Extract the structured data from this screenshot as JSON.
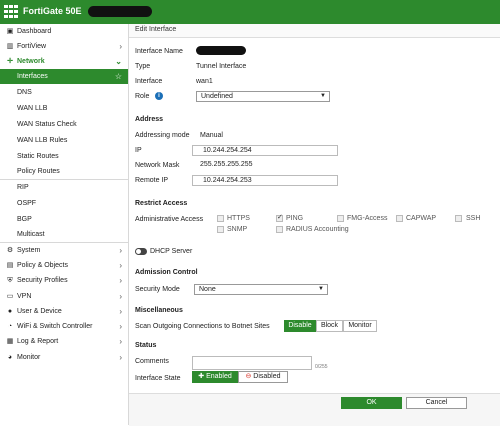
{
  "app": {
    "title": "FortiGate 50E"
  },
  "sidebar": {
    "items": [
      {
        "label": "Dashboard",
        "icon": "dashboard-icon"
      },
      {
        "label": "FortiView",
        "icon": "chart-icon"
      },
      {
        "label": "Network",
        "icon": "network-icon"
      },
      {
        "label": "Interfaces"
      },
      {
        "label": "DNS"
      },
      {
        "label": "WAN LLB"
      },
      {
        "label": "WAN Status Check"
      },
      {
        "label": "WAN LLB Rules"
      },
      {
        "label": "Static Routes"
      },
      {
        "label": "Policy Routes"
      },
      {
        "label": "RIP"
      },
      {
        "label": "OSPF"
      },
      {
        "label": "BGP"
      },
      {
        "label": "Multicast"
      },
      {
        "label": "System",
        "icon": "gear-icon"
      },
      {
        "label": "Policy & Objects",
        "icon": "policy-icon"
      },
      {
        "label": "Security Profiles",
        "icon": "shield-icon"
      },
      {
        "label": "VPN",
        "icon": "vpn-icon"
      },
      {
        "label": "User & Device",
        "icon": "user-icon"
      },
      {
        "label": "WiFi & Switch Controller",
        "icon": "wifi-icon"
      },
      {
        "label": "Log & Report",
        "icon": "log-icon"
      },
      {
        "label": "Monitor",
        "icon": "monitor-icon"
      }
    ]
  },
  "header": {
    "title": "Edit Interface"
  },
  "form": {
    "interface_name_label": "Interface Name",
    "type_label": "Type",
    "type_value": "Tunnel Interface",
    "interface_label": "Interface",
    "interface_value": "wan1",
    "role_label": "Role",
    "role_value": "Undefined",
    "address_heading": "Address",
    "addressing_mode_label": "Addressing mode",
    "addressing_mode_value": "Manual",
    "ip_label": "IP",
    "ip_value": "10.244.254.254",
    "netmask_label": "Network Mask",
    "netmask_value": "255.255.255.255",
    "remote_ip_label": "Remote IP",
    "remote_ip_value": "10.244.254.253",
    "restrict_heading": "Restrict Access",
    "admin_access_label": "Administrative Access",
    "access": {
      "https": "HTTPS",
      "ping": "PING",
      "fmg": "FMG-Access",
      "capwap": "CAPWAP",
      "ssh": "SSH",
      "snmp": "SNMP",
      "radius": "RADIUS Accounting"
    },
    "dhcp_label": "DHCP Server",
    "admission_heading": "Admission Control",
    "security_mode_label": "Security Mode",
    "security_mode_value": "None",
    "misc_heading": "Miscellaneous",
    "botnet_label": "Scan Outgoing Connections to Botnet Sites",
    "botnet_options": [
      "Disable",
      "Block",
      "Monitor"
    ],
    "status_heading": "Status",
    "comments_label": "Comments",
    "comments_counter": "0/255",
    "state_label": "Interface State",
    "enabled_label": "Enabled",
    "disabled_label": "Disabled"
  },
  "footer": {
    "ok": "OK",
    "cancel": "Cancel"
  },
  "colors": {
    "accent": "#2d8a2d",
    "info": "#1b6fb7",
    "disabled_red": "#d9342b"
  }
}
